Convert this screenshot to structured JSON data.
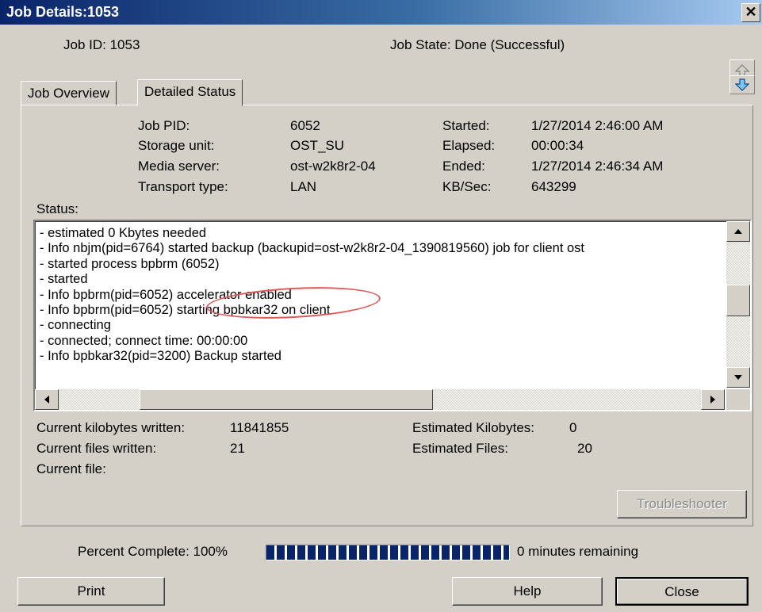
{
  "window": {
    "title": "Job Details:1053",
    "close_glyph": "✕"
  },
  "header": {
    "job_id": "Job ID: 1053",
    "job_state": "Job State: Done (Successful)",
    "nav_up_icon": "up-arrow-icon",
    "nav_down_icon": "down-arrow-icon"
  },
  "tabs": [
    {
      "label": "Job Overview",
      "active": false
    },
    {
      "label": "Detailed Status",
      "active": true
    }
  ],
  "details": {
    "job_pid_label": "Job PID:",
    "job_pid": "6052",
    "storage_unit_label": "Storage unit:",
    "storage_unit": "OST_SU",
    "media_server_label": "Media server:",
    "media_server": "ost-w2k8r2-04",
    "transport_type_label": "Transport type:",
    "transport_type": "LAN",
    "started_label": "Started:",
    "started": "1/27/2014 2:46:00 AM",
    "elapsed_label": "Elapsed:",
    "elapsed": "00:00:34",
    "ended_label": "Ended:",
    "ended": "1/27/2014 2:46:34 AM",
    "kbsec_label": "KB/Sec:",
    "kbsec": "643299"
  },
  "status": {
    "label": "Status:",
    "lines": [
      "- estimated 0 Kbytes needed",
      "- Info nbjm(pid=6764) started backup (backupid=ost-w2k8r2-04_1390819560) job for client ost",
      "- started process bpbrm (6052)",
      "- started",
      "- Info bpbrm(pid=6052) accelerator enabled",
      "- Info bpbrm(pid=6052) starting bpbkar32 on client",
      "- connecting",
      "- connected; connect time: 00:00:00",
      "- Info bpbkar32(pid=3200) Backup started"
    ],
    "highlight_color": "#e05a5a"
  },
  "stats": {
    "kb_written_label": "Current kilobytes written:",
    "kb_written": "11841855",
    "files_written_label": "Current files written:",
    "files_written": "21",
    "current_file_label": "Current file:",
    "est_kb_label": "Estimated Kilobytes:",
    "est_kb": "0",
    "est_files_label": "Estimated Files:",
    "est_files": "20"
  },
  "buttons": {
    "troubleshooter": "Troubleshooter",
    "print": "Print",
    "help": "Help",
    "close": "Close"
  },
  "progress": {
    "label": "Percent Complete: 100%",
    "value": 1.0,
    "remaining": "0 minutes remaining",
    "color": "#0a246a"
  }
}
